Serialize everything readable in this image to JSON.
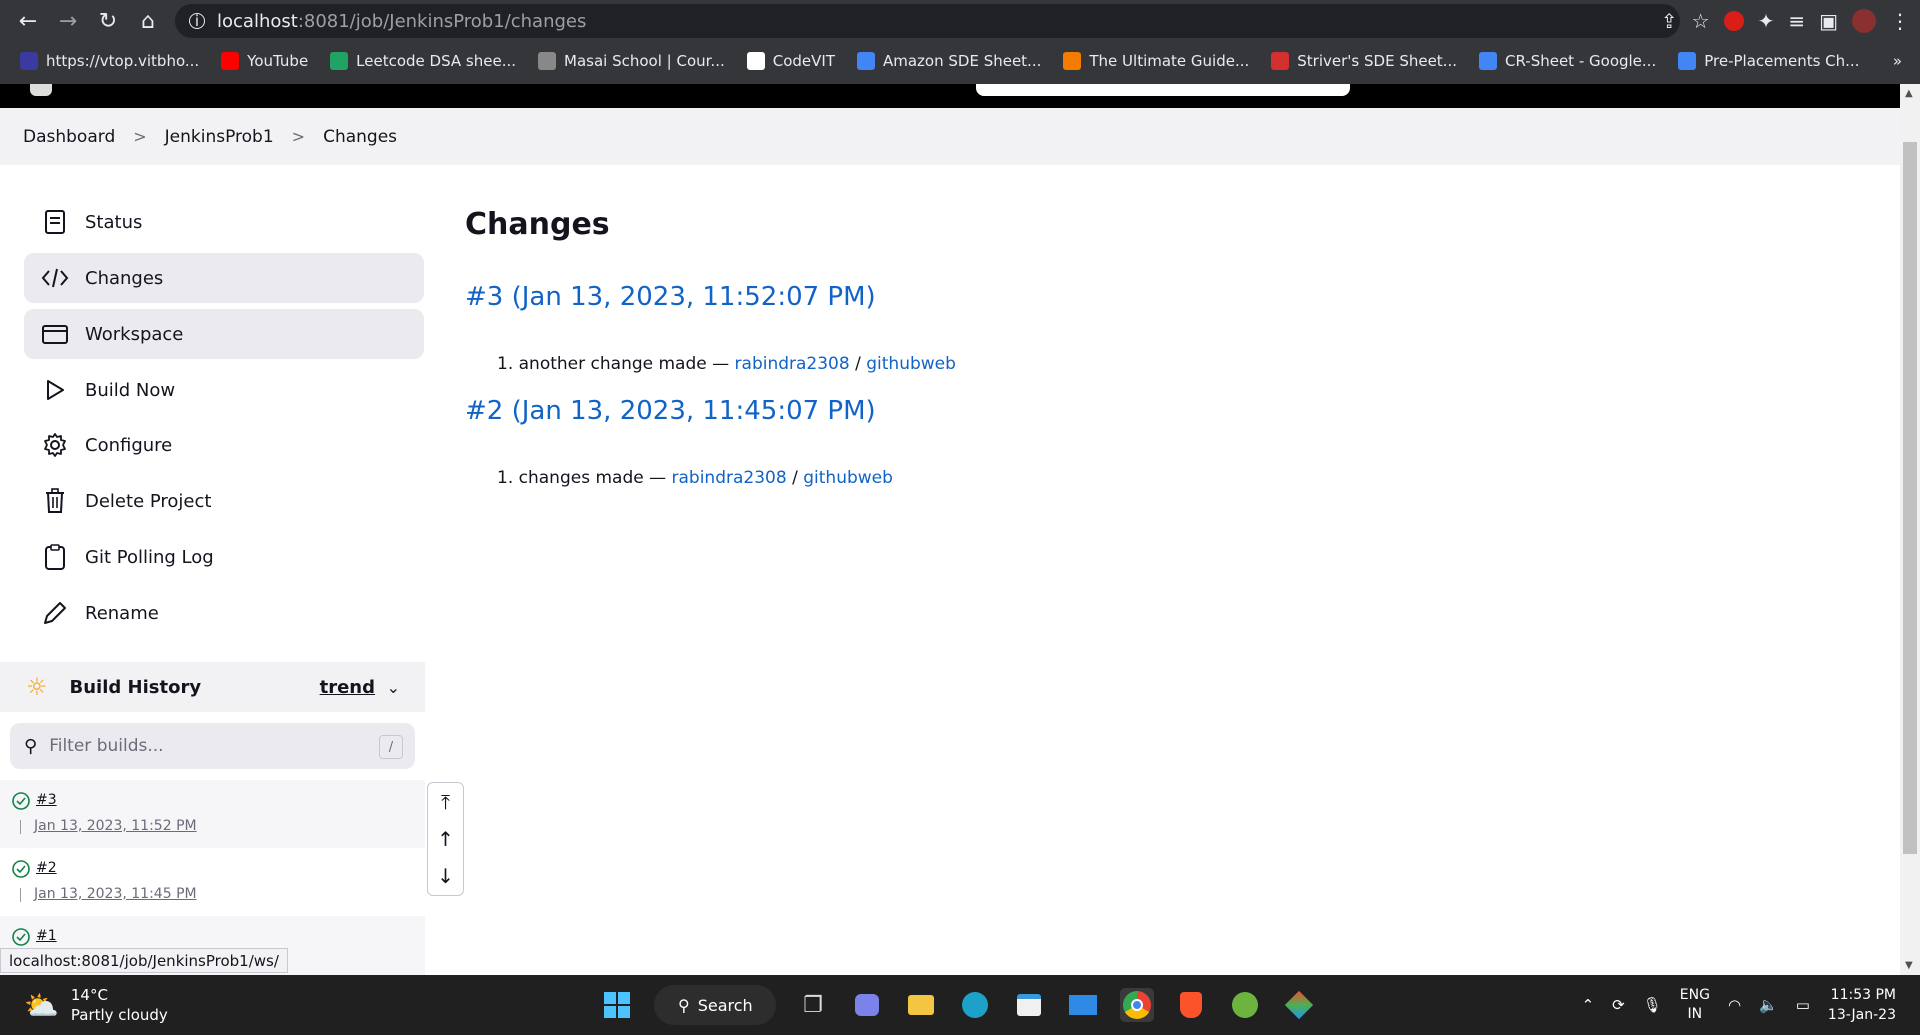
{
  "browser": {
    "url_host": "localhost",
    "url_path": ":8081/job/JenkinsProb1/changes",
    "bookmarks": [
      {
        "label": "https://vtop.vitbho...",
        "color": "#3a3aa0"
      },
      {
        "label": "YouTube",
        "color": "#ff0000"
      },
      {
        "label": "Leetcode DSA shee...",
        "color": "#1fa463"
      },
      {
        "label": "Masai School | Cour...",
        "color": "#888888"
      },
      {
        "label": "CodeVIT",
        "color": "#ffffff"
      },
      {
        "label": "Amazon SDE Sheet...",
        "color": "#4285f4"
      },
      {
        "label": "The Ultimate Guide...",
        "color": "#f57c00"
      },
      {
        "label": "Striver's SDE Sheet...",
        "color": "#d32f2f"
      },
      {
        "label": "CR-Sheet - Google...",
        "color": "#4285f4"
      },
      {
        "label": "Pre-Placements Ch...",
        "color": "#4285f4"
      }
    ],
    "more_bookmarks": "»"
  },
  "breadcrumb": {
    "items": [
      "Dashboard",
      "JenkinsProb1",
      "Changes"
    ],
    "sep": ">"
  },
  "sidebar": {
    "items": [
      {
        "label": "Status",
        "icon": "document-icon"
      },
      {
        "label": "Changes",
        "icon": "code-icon"
      },
      {
        "label": "Workspace",
        "icon": "folder-icon"
      },
      {
        "label": "Build Now",
        "icon": "play-icon"
      },
      {
        "label": "Configure",
        "icon": "gear-icon"
      },
      {
        "label": "Delete Project",
        "icon": "trash-icon"
      },
      {
        "label": "Git Polling Log",
        "icon": "clipboard-icon"
      },
      {
        "label": "Rename",
        "icon": "pencil-icon"
      }
    ]
  },
  "build_history": {
    "title": "Build History",
    "trend": "trend",
    "filter_placeholder": "Filter builds...",
    "filter_shortcut": "/",
    "builds": [
      {
        "number": "#3",
        "date": "Jan 13, 2023, 11:52 PM"
      },
      {
        "number": "#2",
        "date": "Jan 13, 2023, 11:45 PM"
      },
      {
        "number": "#1",
        "date": ""
      }
    ]
  },
  "status_url": "localhost:8081/job/JenkinsProb1/ws/",
  "main": {
    "title": "Changes",
    "changesets": [
      {
        "heading": "#3 (Jan 13, 2023, 11:52:07 PM)",
        "index": "1.",
        "message": "another change made —",
        "author": "rabindra2308",
        "slash": "/",
        "repo": "githubweb"
      },
      {
        "heading": "#2 (Jan 13, 2023, 11:45:07 PM)",
        "index": "1.",
        "message": "changes made —",
        "author": "rabindra2308",
        "slash": "/",
        "repo": "githubweb"
      }
    ]
  },
  "taskbar": {
    "temp": "14°C",
    "weather": "Partly cloudy",
    "search": "Search",
    "lang1": "ENG",
    "lang2": "IN",
    "time": "11:53 PM",
    "date": "13-Jan-23"
  },
  "colors": {
    "link": "#1163c8",
    "success": "#138347",
    "sun": "#f5a623"
  }
}
